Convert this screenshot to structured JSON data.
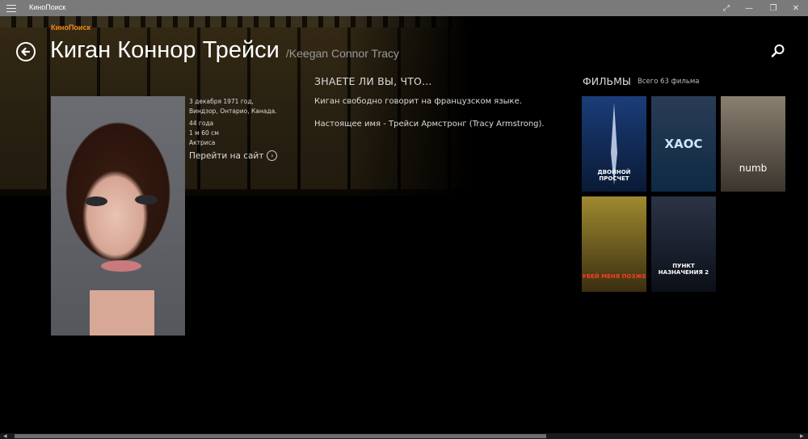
{
  "window": {
    "title": "КиноПоиск"
  },
  "header": {
    "logo": "КиноПоиск",
    "name_ru": "Киган Коннор Трейси",
    "name_orig": "/Keegan Connor Tracy"
  },
  "person": {
    "born": "3 декабря 1971 год, Виндзор, Онтарио, Канада.",
    "age": "44 года",
    "height": "1 м 60 см",
    "profession": "Актриса",
    "site_link": "Перейти на сайт"
  },
  "facts": {
    "heading": "ЗНАЕТЕ ЛИ ВЫ, ЧТО...",
    "items": [
      "Киган свободно говорит на французском языке.",
      "Настоящее имя - Трейси Армстронг (Tracy Armstrong)."
    ]
  },
  "films": {
    "heading": "ФИЛЬМЫ",
    "count": "Всего 63 фильма",
    "posters": [
      {
        "caption": "ДВОЙНОЙ ПРОСЧЕТ",
        "bg": "#0f2a57"
      },
      {
        "caption": "ХАОС",
        "bg": "#123a5e"
      },
      {
        "caption": "numb",
        "bg": "#6a6258"
      },
      {
        "caption": "УБЕЙ МЕНЯ ПОЗЖЕ",
        "bg": "#6a5a20"
      },
      {
        "caption": "ПУНКТ НАЗНАЧЕНИЯ 2",
        "bg": "#1c2230"
      }
    ]
  },
  "colors": {
    "accent": "#f28a1a",
    "titlebar": "#7a7a7a"
  }
}
